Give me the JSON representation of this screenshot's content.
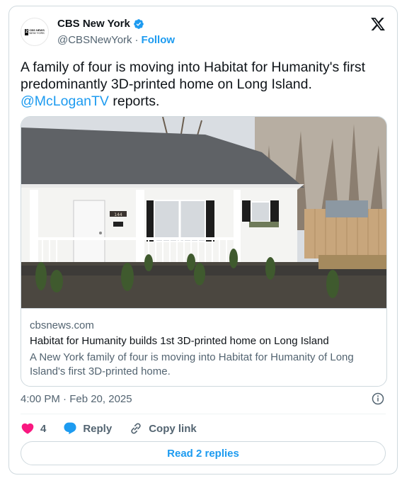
{
  "author": {
    "name": "CBS New York",
    "handle": "@CBSNewYork",
    "separator": "·",
    "follow_label": "Follow",
    "avatar_badge": "2",
    "avatar_text_line1": "CBS NEWS",
    "avatar_text_line2": "NEW YORK"
  },
  "tweet": {
    "text": "A family of four is moving into Habitat for Humanity's first predominantly 3D-printed home on Long Island.",
    "mention": "@McLoganTV",
    "text_suffix": " reports."
  },
  "link_card": {
    "domain": "cbsnews.com",
    "title": "Habitat for Humanity builds 1st 3D-printed home on Long Island",
    "description": "A New York family of four is moving into Habitat for Humanity of Long Island's first 3D-printed home.",
    "house_number": "144"
  },
  "timestamp": "4:00 PM · Feb 20, 2025",
  "actions": {
    "like_count": "4",
    "reply_label": "Reply",
    "copy_label": "Copy link"
  },
  "read_replies_label": "Read 2 replies",
  "colors": {
    "accent": "#1d9bf0",
    "like": "#f91880",
    "secondary_text": "#536471",
    "border": "#cfd9de"
  },
  "icons": [
    "verified-badge-icon",
    "x-logo-icon",
    "info-icon",
    "heart-icon",
    "reply-bubble-icon",
    "copy-link-icon"
  ]
}
